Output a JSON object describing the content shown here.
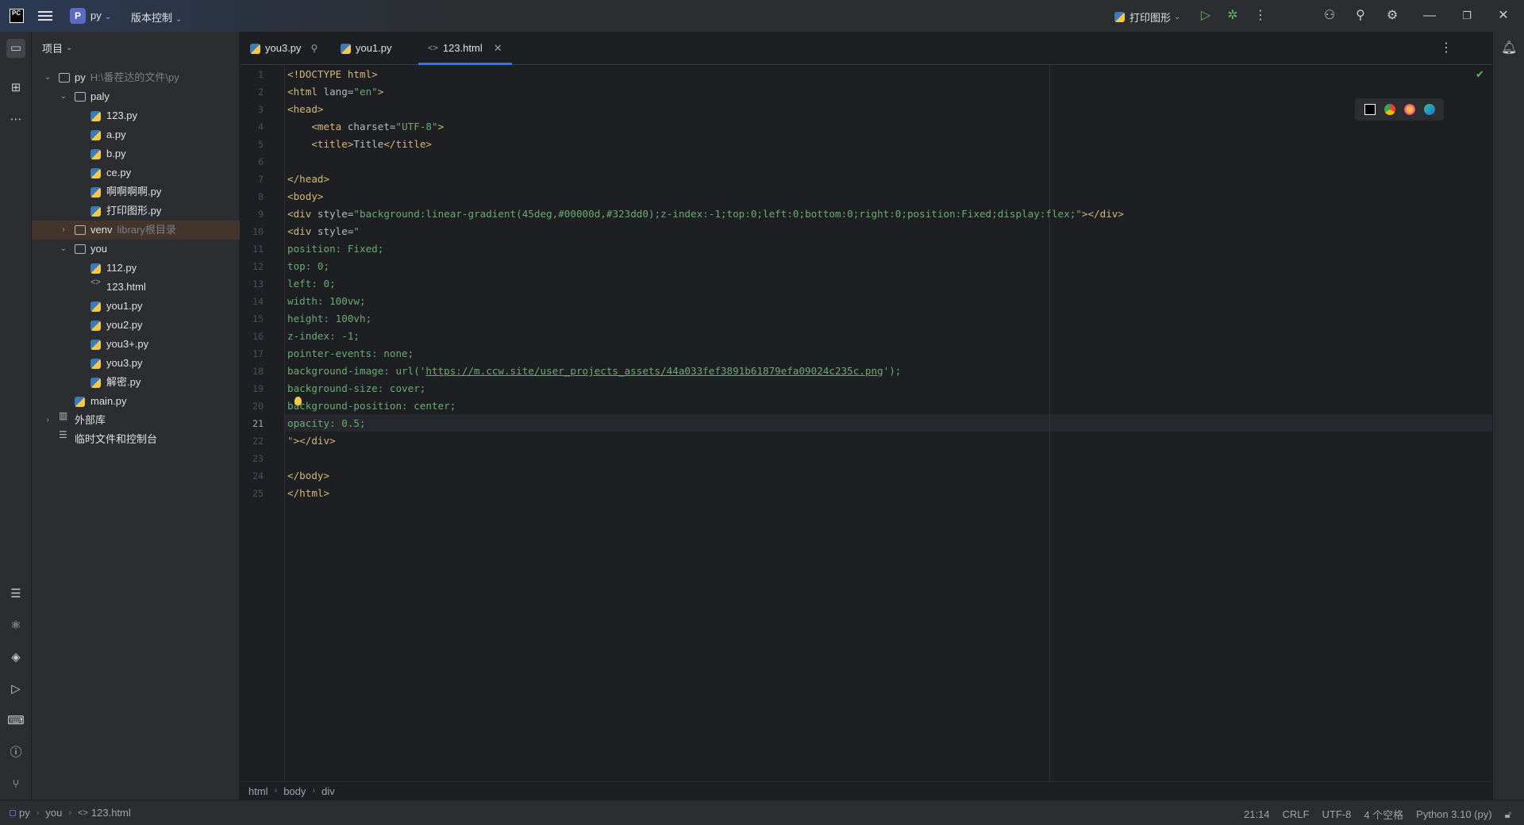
{
  "titlebar": {
    "app_logo": "PC",
    "project_badge": "P",
    "project_name": "py",
    "vcs_label": "版本控制",
    "run_config": "打印图形"
  },
  "project_panel": {
    "title": "项目",
    "tree": [
      {
        "label": "py",
        "hint": "H:\\番茬达的文件\\py",
        "kind": "folder",
        "expanded": true
      },
      {
        "label": "paly",
        "hint": "",
        "kind": "folder",
        "expanded": true
      },
      {
        "label": "123.py",
        "hint": "",
        "kind": "py"
      },
      {
        "label": "a.py",
        "hint": "",
        "kind": "py"
      },
      {
        "label": "b.py",
        "hint": "",
        "kind": "py"
      },
      {
        "label": "ce.py",
        "hint": "",
        "kind": "py"
      },
      {
        "label": "啊啊啊啊.py",
        "hint": "",
        "kind": "py"
      },
      {
        "label": "打印图形.py",
        "hint": "",
        "kind": "py"
      },
      {
        "label": "venv",
        "hint": "library根目录",
        "kind": "folder",
        "expanded": false
      },
      {
        "label": "you",
        "hint": "",
        "kind": "folder",
        "expanded": true
      },
      {
        "label": "112.py",
        "hint": "",
        "kind": "py"
      },
      {
        "label": "123.html",
        "hint": "",
        "kind": "html"
      },
      {
        "label": "you1.py",
        "hint": "",
        "kind": "py"
      },
      {
        "label": "you2.py",
        "hint": "",
        "kind": "py"
      },
      {
        "label": "you3+.py",
        "hint": "",
        "kind": "py"
      },
      {
        "label": "you3.py",
        "hint": "",
        "kind": "py"
      },
      {
        "label": "解密.py",
        "hint": "",
        "kind": "py"
      },
      {
        "label": "main.py",
        "hint": "",
        "kind": "py"
      },
      {
        "label": "外部库",
        "hint": "",
        "kind": "lib",
        "expanded": false
      },
      {
        "label": "临时文件和控制台",
        "hint": "",
        "kind": "scratch"
      }
    ]
  },
  "tabs": [
    {
      "label": "you3.py",
      "active": false
    },
    {
      "label": "you1.py",
      "active": false
    },
    {
      "label": "123.html",
      "active": true
    }
  ],
  "editor": {
    "current_line": 21,
    "lines": [
      "1",
      "2",
      "3",
      "4",
      "5",
      "6",
      "7",
      "8",
      "9",
      "10",
      "11",
      "12",
      "13",
      "14",
      "15",
      "16",
      "17",
      "18",
      "19",
      "20",
      "21",
      "22",
      "23",
      "24",
      "25"
    ],
    "code": {
      "l1_tag": "<!DOCTYPE html>",
      "l2_open": "<html ",
      "l2_attr": "lang=",
      "l2_val": "\"en\"",
      "l2_close": ">",
      "l3": "<head>",
      "l4_open": "    <meta ",
      "l4_attr": "charset=",
      "l4_val": "\"UTF-8\"",
      "l4_close": ">",
      "l5_open": "    <title>",
      "l5_text": "Title",
      "l5_close": "</title>",
      "l7": "</head>",
      "l8": "<body>",
      "l9_open": "<div ",
      "l9_attr": "style=",
      "l9_val": "\"background:linear-gradient(45deg,#00000d,#323dd0);z-index:-1;top:0;left:0;bottom:0;right:0;position:Fixed;display:flex;\"",
      "l9_close": "></div>",
      "l10_open": "<div ",
      "l10_attr": "style=",
      "l10_val": "\"",
      "l11": "position: Fixed;",
      "l12": "top: 0;",
      "l13": "left: 0;",
      "l14": "width: 100vw;",
      "l15": "height: 100vh;",
      "l16": "z-index: -1;",
      "l17": "pointer-events: none;",
      "l18_pre": "background-image: url('",
      "l18_url": "https://m.ccw.site/user_projects_assets/44a033fef3891b61879efa09024c235c.png",
      "l18_post": "');",
      "l19": "background-size: cover;",
      "l20": "background-position: center;",
      "l21": "opacity: 0.5;",
      "l22_val": "\"",
      "l22_close": "></div>",
      "l24": "</body>",
      "l25": "</html>"
    }
  },
  "breadcrumb": [
    "html",
    "body",
    "div"
  ],
  "statusbar": {
    "path": [
      "py",
      "you",
      "123.html"
    ],
    "position": "21:14",
    "line_sep": "CRLF",
    "encoding": "UTF-8",
    "indent": "4 个空格",
    "interpreter": "Python 3.10 (py)"
  }
}
